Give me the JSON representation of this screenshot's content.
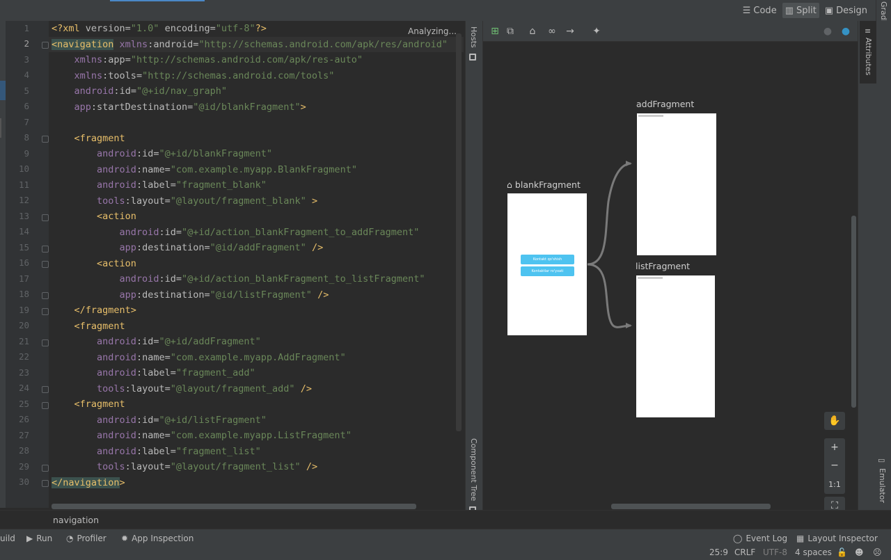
{
  "view_modes": {
    "code": "Code",
    "split": "Split",
    "design": "Design",
    "active": "Split"
  },
  "gradle_label": "Gradle",
  "status_text": "Analyzing...",
  "current_line": "2",
  "line_numbers": [
    "1",
    "2",
    "3",
    "4",
    "5",
    "6",
    "7",
    "8",
    "9",
    "10",
    "11",
    "12",
    "13",
    "14",
    "15",
    "16",
    "17",
    "18",
    "19",
    "20",
    "21",
    "22",
    "23",
    "24",
    "25",
    "26",
    "27",
    "28",
    "29",
    "30"
  ],
  "code_lines": [
    "<?xml version=\"1.0\" encoding=\"utf-8\"?>",
    "<navigation xmlns:android=\"http://schemas.android.com/apk/res/android\"",
    "    xmlns:app=\"http://schemas.android.com/apk/res-auto\"",
    "    xmlns:tools=\"http://schemas.android.com/tools\"",
    "    android:id=\"@+id/nav_graph\"",
    "    app:startDestination=\"@id/blankFragment\">",
    "",
    "    <fragment",
    "        android:id=\"@+id/blankFragment\"",
    "        android:name=\"com.example.myapp.BlankFragment\"",
    "        android:label=\"fragment_blank\"",
    "        tools:layout=\"@layout/fragment_blank\" >",
    "        <action",
    "            android:id=\"@+id/action_blankFragment_to_addFragment\"",
    "            app:destination=\"@id/addFragment\" />",
    "        <action",
    "            android:id=\"@+id/action_blankFragment_to_listFragment\"",
    "            app:destination=\"@id/listFragment\" />",
    "    </fragment>",
    "    <fragment",
    "        android:id=\"@+id/addFragment\"",
    "        android:name=\"com.example.myapp.AddFragment\"",
    "        android:label=\"fragment_add\"",
    "        tools:layout=\"@layout/fragment_add\" />",
    "    <fragment",
    "        android:id=\"@+id/listFragment\"",
    "        android:name=\"com.example.myapp.ListFragment\"",
    "        android:label=\"fragment_list\"",
    "        tools:layout=\"@layout/fragment_list\" />",
    "</navigation>"
  ],
  "side_tabs": {
    "hosts": "Hosts",
    "component_tree": "Component Tree",
    "attributes": "Attributes",
    "emulator": "Emulator"
  },
  "nav_graph": {
    "start_fragment": "blankFragment",
    "fragments": [
      "blankFragment",
      "addFragment",
      "listFragment"
    ],
    "blank_buttons": [
      "Kontakt qo'shish",
      "Kontaktlar ro'yxati"
    ],
    "zoom_controls": {
      "fit": "1:1"
    }
  },
  "breadcrumb": "navigation",
  "toolbar": {
    "build": "uild",
    "run": "Run",
    "profiler": "Profiler",
    "app_inspection": "App Inspection",
    "event_log": "Event Log",
    "layout_inspector": "Layout Inspector"
  },
  "status": {
    "position": "25:9",
    "line_sep": "CRLF",
    "encoding": "UTF-8",
    "indent": "4 spaces"
  }
}
